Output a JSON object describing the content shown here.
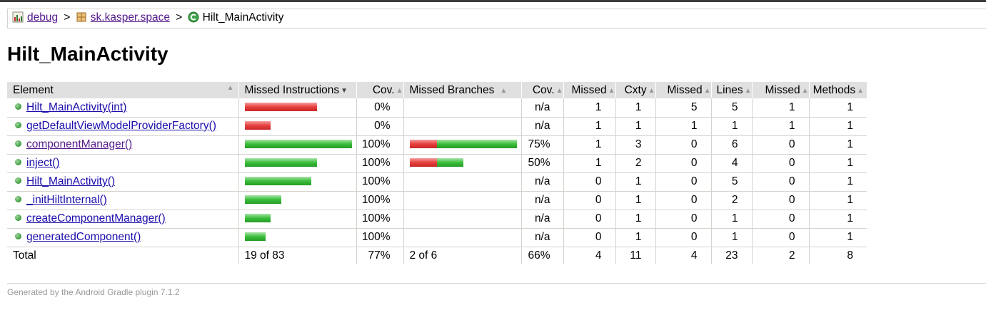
{
  "breadcrumb": {
    "items": [
      {
        "label": "debug",
        "icon": "report-icon",
        "link": true
      },
      {
        "label": "sk.kasper.space",
        "icon": "package-icon",
        "link": true
      },
      {
        "label": "Hilt_MainActivity",
        "icon": "class-icon",
        "link": false
      }
    ],
    "separator": ">"
  },
  "page_title": "Hilt_MainActivity",
  "table": {
    "headers": {
      "element": "Element",
      "missed_instructions": "Missed Instructions",
      "cov_instructions": "Cov.",
      "missed_branches": "Missed Branches",
      "cov_branches": "Cov.",
      "missed_cxty": "Missed",
      "cxty": "Cxty",
      "missed_lines": "Missed",
      "lines": "Lines",
      "missed_methods": "Missed",
      "methods": "Methods"
    },
    "rows": [
      {
        "element": "Hilt_MainActivity(int)",
        "instr_missed_frac": 1.0,
        "instr_covered_frac": 0.0,
        "instr_size": 0.67,
        "cov_instr": "0%",
        "branch_missed_frac": null,
        "branch_covered_frac": null,
        "branch_size": 0,
        "cov_branch": "n/a",
        "missed_cxty": "1",
        "cxty": "1",
        "missed_lines": "5",
        "lines": "5",
        "missed_methods": "1",
        "methods": "1"
      },
      {
        "element": "getDefaultViewModelProviderFactory()",
        "instr_missed_frac": 1.0,
        "instr_covered_frac": 0.0,
        "instr_size": 0.24,
        "cov_instr": "0%",
        "branch_missed_frac": null,
        "branch_covered_frac": null,
        "branch_size": 0,
        "cov_branch": "n/a",
        "missed_cxty": "1",
        "cxty": "1",
        "missed_lines": "1",
        "lines": "1",
        "missed_methods": "1",
        "methods": "1"
      },
      {
        "element": "componentManager()",
        "instr_missed_frac": 0.0,
        "instr_covered_frac": 1.0,
        "instr_size": 1.0,
        "cov_instr": "100%",
        "branch_missed_frac": 0.25,
        "branch_covered_frac": 0.75,
        "branch_size": 1.0,
        "cov_branch": "75%",
        "missed_cxty": "1",
        "cxty": "3",
        "missed_lines": "0",
        "lines": "6",
        "missed_methods": "0",
        "methods": "1",
        "visited": true
      },
      {
        "element": "inject()",
        "instr_missed_frac": 0.0,
        "instr_covered_frac": 1.0,
        "instr_size": 0.67,
        "cov_instr": "100%",
        "branch_missed_frac": 0.5,
        "branch_covered_frac": 0.5,
        "branch_size": 0.5,
        "cov_branch": "50%",
        "missed_cxty": "1",
        "cxty": "2",
        "missed_lines": "0",
        "lines": "4",
        "missed_methods": "0",
        "methods": "1"
      },
      {
        "element": "Hilt_MainActivity()",
        "instr_missed_frac": 0.0,
        "instr_covered_frac": 1.0,
        "instr_size": 0.62,
        "cov_instr": "100%",
        "branch_missed_frac": null,
        "branch_covered_frac": null,
        "branch_size": 0,
        "cov_branch": "n/a",
        "missed_cxty": "0",
        "cxty": "1",
        "missed_lines": "0",
        "lines": "5",
        "missed_methods": "0",
        "methods": "1"
      },
      {
        "element": "_initHiltInternal()",
        "instr_missed_frac": 0.0,
        "instr_covered_frac": 1.0,
        "instr_size": 0.34,
        "cov_instr": "100%",
        "branch_missed_frac": null,
        "branch_covered_frac": null,
        "branch_size": 0,
        "cov_branch": "n/a",
        "missed_cxty": "0",
        "cxty": "1",
        "missed_lines": "0",
        "lines": "2",
        "missed_methods": "0",
        "methods": "1"
      },
      {
        "element": "createComponentManager()",
        "instr_missed_frac": 0.0,
        "instr_covered_frac": 1.0,
        "instr_size": 0.24,
        "cov_instr": "100%",
        "branch_missed_frac": null,
        "branch_covered_frac": null,
        "branch_size": 0,
        "cov_branch": "n/a",
        "missed_cxty": "0",
        "cxty": "1",
        "missed_lines": "0",
        "lines": "1",
        "missed_methods": "0",
        "methods": "1"
      },
      {
        "element": "generatedComponent()",
        "instr_missed_frac": 0.0,
        "instr_covered_frac": 1.0,
        "instr_size": 0.19,
        "cov_instr": "100%",
        "branch_missed_frac": null,
        "branch_covered_frac": null,
        "branch_size": 0,
        "cov_branch": "n/a",
        "missed_cxty": "0",
        "cxty": "1",
        "missed_lines": "0",
        "lines": "1",
        "missed_methods": "0",
        "methods": "1"
      }
    ],
    "total": {
      "label": "Total",
      "missed_instructions": "19 of 83",
      "cov_instr": "77%",
      "missed_branches": "2 of 6",
      "cov_branch": "66%",
      "missed_cxty": "4",
      "cxty": "11",
      "missed_lines": "4",
      "lines": "23",
      "missed_methods": "2",
      "methods": "8"
    }
  },
  "colors": {
    "missed": "#e6403d",
    "covered": "#3cbf3c",
    "header_bg": "#e0e0e0"
  },
  "footer": "Generated by the Android Gradle plugin 7.1.2"
}
